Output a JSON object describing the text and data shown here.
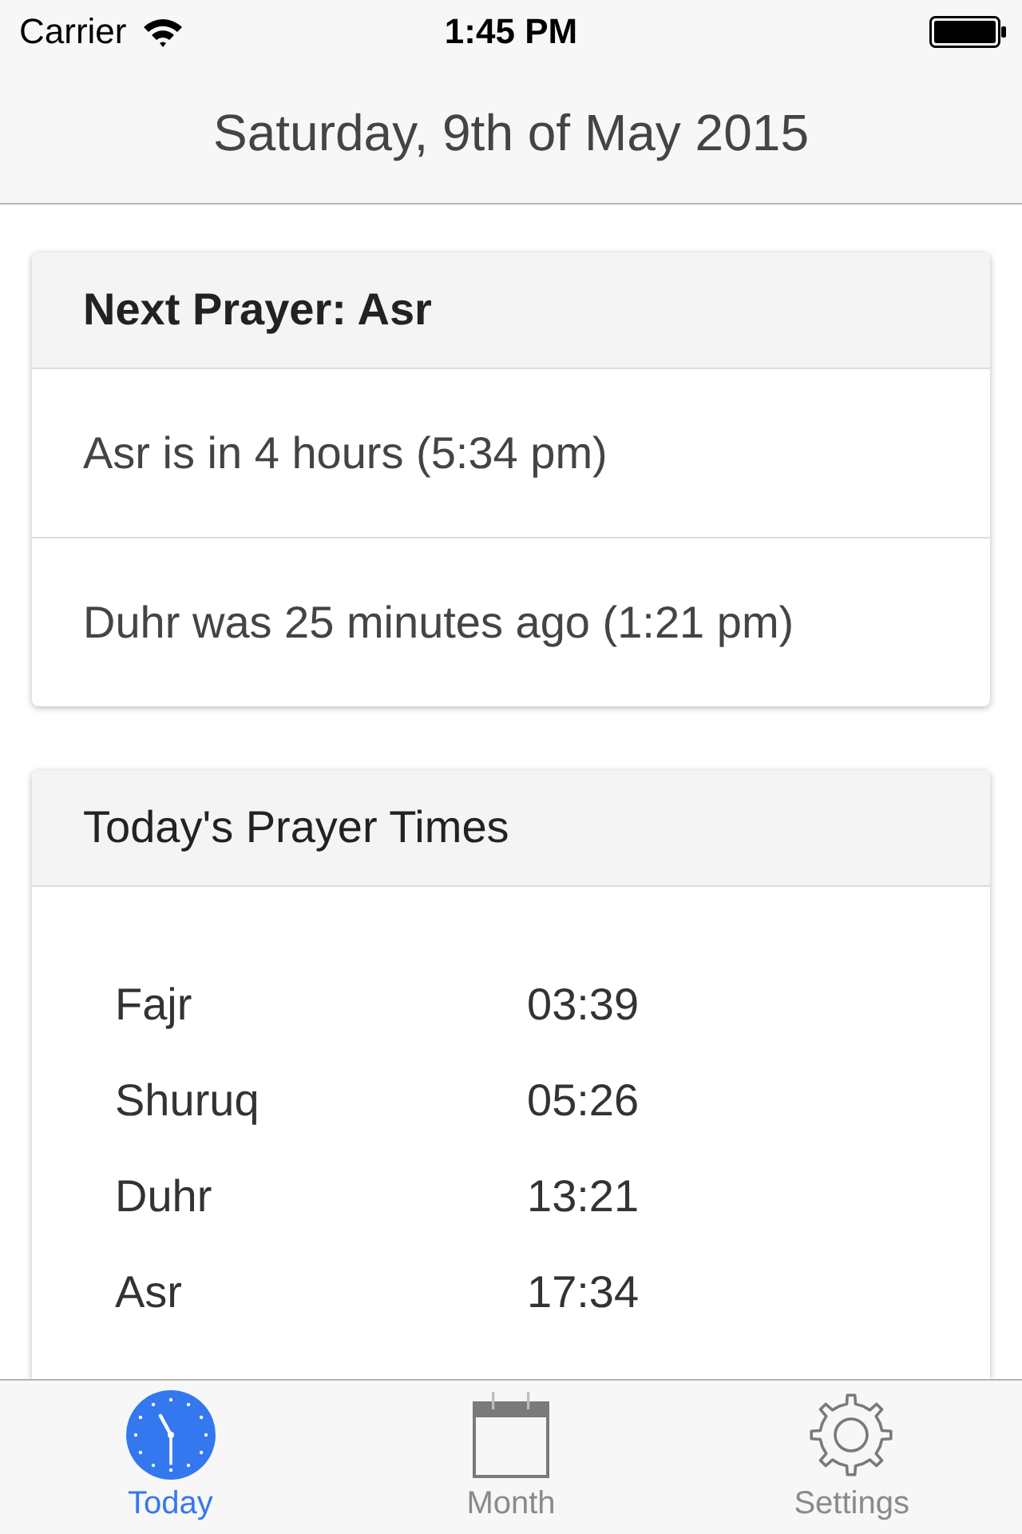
{
  "status_bar": {
    "carrier": "Carrier",
    "time": "1:45 PM"
  },
  "nav_bar": {
    "title": "Saturday, 9th of May 2015"
  },
  "next_prayer_card": {
    "title": "Next Prayer: Asr",
    "rows": [
      "Asr is in 4 hours (5:34 pm)",
      "Duhr was 25 minutes ago (1:21 pm)"
    ]
  },
  "prayer_times_card": {
    "title": "Today's Prayer Times",
    "rows": [
      {
        "name": "Fajr",
        "time": "03:39"
      },
      {
        "name": "Shuruq",
        "time": "05:26"
      },
      {
        "name": "Duhr",
        "time": "13:21"
      },
      {
        "name": "Asr",
        "time": "17:34"
      }
    ]
  },
  "tab_bar": {
    "tabs": [
      {
        "label": "Today",
        "kind": "clock",
        "selected": true
      },
      {
        "label": "Month",
        "kind": "calendar",
        "selected": false
      },
      {
        "label": "Settings",
        "kind": "gear",
        "selected": false
      }
    ]
  }
}
